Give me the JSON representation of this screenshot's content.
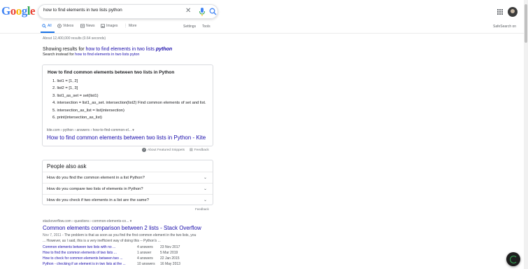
{
  "logo": {
    "text": "Google"
  },
  "search": {
    "query": "how to find elements in two lists python"
  },
  "tabs": [
    {
      "label": "All",
      "icon": "search-icon"
    },
    {
      "label": "Videos",
      "icon": "video-icon"
    },
    {
      "label": "News",
      "icon": "news-icon"
    },
    {
      "label": "Images",
      "icon": "image-icon"
    },
    {
      "label": "More",
      "icon": "more-icon"
    }
  ],
  "tools": {
    "settings": "Settings",
    "tools": "Tools",
    "safesearch": "SafeSearch on"
  },
  "stats": "About 12,400,000 results (0.64 seconds)",
  "spelling": {
    "showing_prefix": "Showing results for",
    "showing_query": "how to find elements in two lists",
    "showing_em": "python",
    "instead_prefix": "Search instead for",
    "instead_query": "how to find elements in two lists pyton"
  },
  "featured": {
    "title": "How to find common elements between two lists in Python",
    "steps": [
      "list1 = [1, 2]",
      "list2 = [1, 3]",
      "list1_as_set = set(list1)",
      "intersection = list1_as_set. intersection(list2) Find common elements of set and list.",
      "intersection_as_list = list(intersection)",
      "print(intersection_as_list)"
    ],
    "url": "kite.com › python › answers › how-to-find-common-el...",
    "link": "How to find common elements between two lists in Python - Kite",
    "about": "About Featured Snippets",
    "feedback": "Feedback"
  },
  "paa": {
    "title": "People also ask",
    "questions": [
      "How do you find the common element in a list Python?",
      "How do you compare two lists of elements in Python?",
      "How do you check if two elements in a list are the same?"
    ],
    "feedback": "Feedback"
  },
  "result": {
    "url": "stackoverflow.com › questions › common-elements-co...",
    "title": "Common elements comparison between 2 lists - Stack Overflow",
    "date": "Nov 7, 2011",
    "snippet": " - The problem is that as soon as you find the first common element in the two lists, you ... However, as I said, this is a very inefficient way of doing this -- Python's ...",
    "sublinks": [
      {
        "label": "Common elements between two lists with no ...",
        "answers": "4 answers",
        "date": "23 Nov 2017"
      },
      {
        "label": "How to find the common elements of two lists ...",
        "answers": "1 answer",
        "date": "5 Mar 2019"
      },
      {
        "label": "How to check for common elements between two ...",
        "answers": "4 answers",
        "date": "22 Jan 2015"
      },
      {
        "label": "Python - checking if an element is in two lists at the ...",
        "answers": "10 answers",
        "date": "16 May 2013"
      }
    ]
  }
}
